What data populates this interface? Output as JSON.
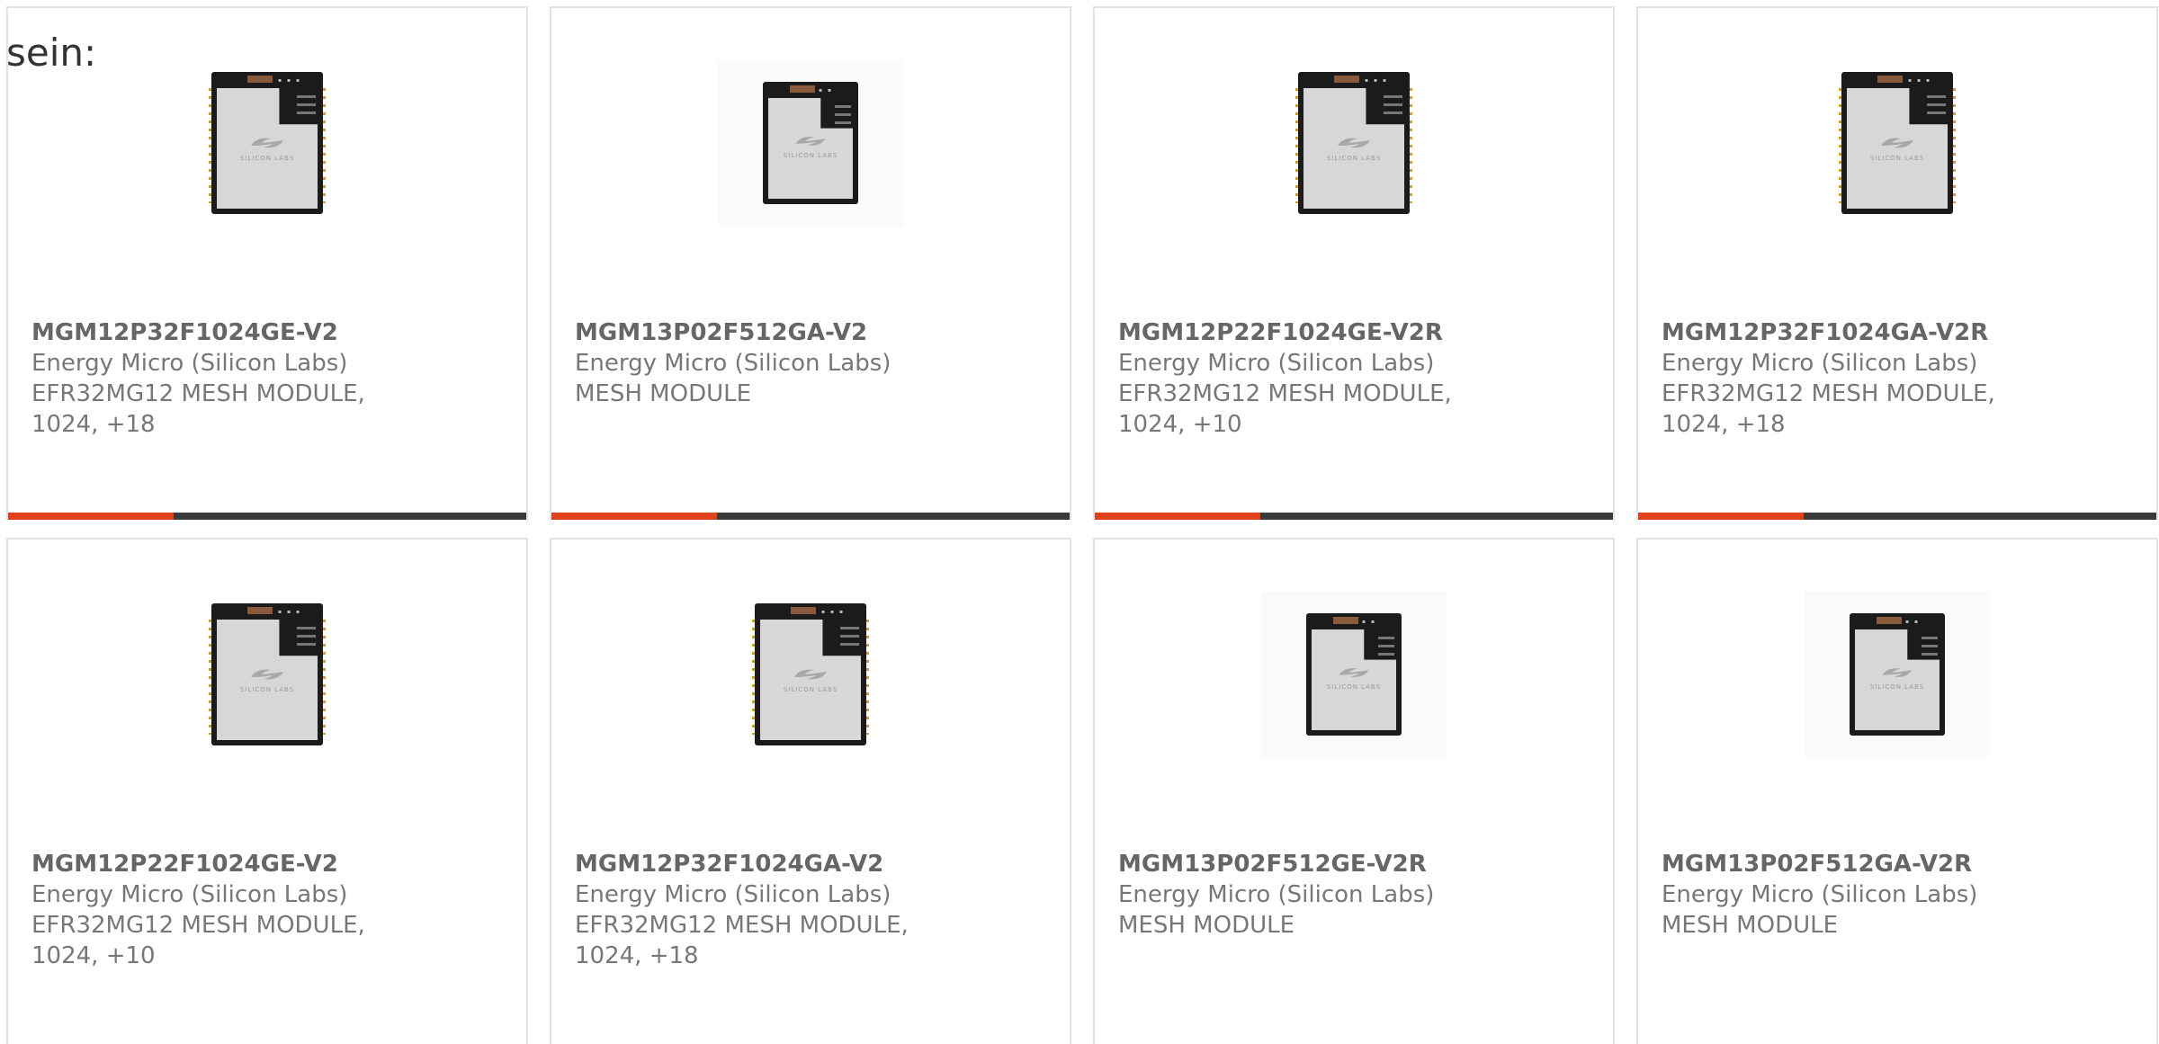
{
  "intro_text": "sein:",
  "colors": {
    "accent": "#e0401a",
    "bar_dark": "#3a3a3a",
    "card_border": "#e3e3e3",
    "title": "#666666",
    "text": "#777777"
  },
  "products": [
    {
      "part": "MGM12P32F1024GE-V2",
      "maker": "Energy Micro (Silicon Labs)",
      "desc": "EFR32MG12 MESH MODULE, 1024, +18",
      "image": "silicon-labs-module"
    },
    {
      "part": "MGM13P02F512GA-V2",
      "maker": "Energy Micro (Silicon Labs)",
      "desc": "MESH MODULE",
      "image": "silicon-labs-module"
    },
    {
      "part": "MGM12P22F1024GE-V2R",
      "maker": "Energy Micro (Silicon Labs)",
      "desc": "EFR32MG12 MESH MODULE, 1024, +10",
      "image": "silicon-labs-module"
    },
    {
      "part": "MGM12P32F1024GA-V2R",
      "maker": "Energy Micro (Silicon Labs)",
      "desc": "EFR32MG12 MESH MODULE, 1024, +18",
      "image": "silicon-labs-module"
    },
    {
      "part": "MGM12P22F1024GE-V2",
      "maker": "Energy Micro (Silicon Labs)",
      "desc": "EFR32MG12 MESH MODULE, 1024, +10",
      "image": "silicon-labs-module"
    },
    {
      "part": "MGM12P32F1024GA-V2",
      "maker": "Energy Micro (Silicon Labs)",
      "desc": "EFR32MG12 MESH MODULE, 1024, +18",
      "image": "silicon-labs-module"
    },
    {
      "part": "MGM13P02F512GE-V2R",
      "maker": "Energy Micro (Silicon Labs)",
      "desc": "MESH MODULE",
      "image": "silicon-labs-module"
    },
    {
      "part": "MGM13P02F512GA-V2R",
      "maker": "Energy Micro (Silicon Labs)",
      "desc": "MESH MODULE",
      "image": "silicon-labs-module"
    }
  ]
}
